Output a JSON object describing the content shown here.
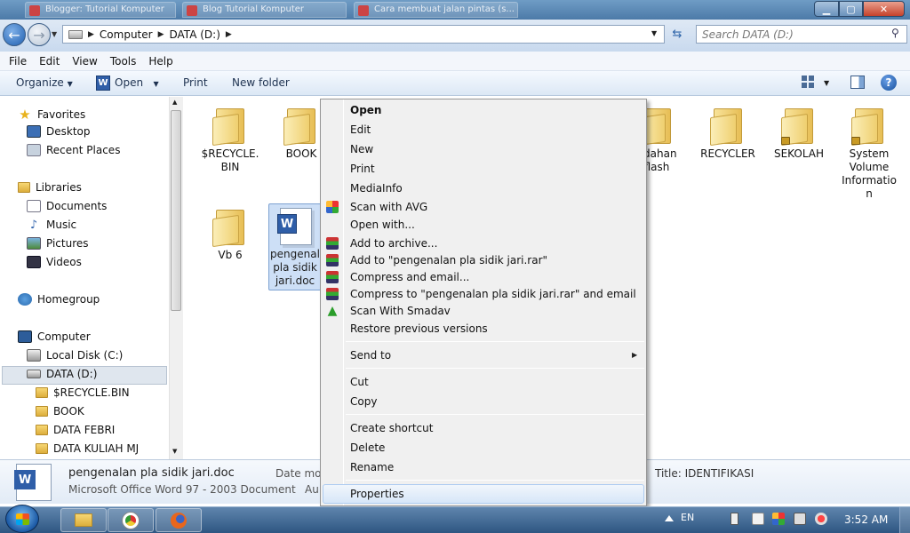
{
  "window": {
    "ghost_tabs": [
      "Blogger: Tutorial Komputer",
      "Blog Tutorial Komputer",
      "Cara membuat jalan pintas (s..."
    ]
  },
  "address": {
    "crumbs": [
      "Computer",
      "DATA (D:)"
    ],
    "search_placeholder": "Search DATA (D:)"
  },
  "menubar": [
    "File",
    "Edit",
    "View",
    "Tools",
    "Help"
  ],
  "toolbar": {
    "organize": "Organize",
    "open": "Open",
    "print": "Print",
    "new_folder": "New folder"
  },
  "nav": {
    "favorites": "Favorites",
    "desktop": "Desktop",
    "recent": "Recent Places",
    "libraries": "Libraries",
    "documents": "Documents",
    "music": "Music",
    "pictures": "Pictures",
    "videos": "Videos",
    "homegroup": "Homegroup",
    "computer": "Computer",
    "local_disk": "Local Disk (C:)",
    "data_d": "DATA (D:)",
    "sub": [
      "$RECYCLE.BIN",
      "BOOK",
      "DATA FEBRI",
      "DATA KULIAH MJ"
    ]
  },
  "files": {
    "recycle": "$RECYCLE.\nBIN",
    "book": "BOOK",
    "vb6": "Vb 6",
    "doc": "pengenalan pla sidik jari.doc",
    "pindahan": "ndahan flash",
    "recycler": "RECYCLER",
    "sekolah": "SEKOLAH",
    "svi": "System Volume Informatio n"
  },
  "details": {
    "name": "pengenalan pla sidik jari.doc",
    "type": "Microsoft Office Word 97 - 2003 Document",
    "date_label": "Date mod",
    "author_label": "Au",
    "title": "Title: IDENTIFIKASI"
  },
  "context_menu": {
    "open": "Open",
    "edit": "Edit",
    "new": "New",
    "print": "Print",
    "mediainfo": "MediaInfo",
    "scan_avg": "Scan with AVG",
    "open_with": "Open with...",
    "add_archive": "Add to archive...",
    "add_rar": "Add to \"pengenalan pla sidik jari.rar\"",
    "compress_email": "Compress and email...",
    "compress_rar_email": "Compress to \"pengenalan pla sidik jari.rar\" and email",
    "smadav": "Scan With Smadav",
    "restore": "Restore previous versions",
    "send_to": "Send to",
    "cut": "Cut",
    "copy": "Copy",
    "create_shortcut": "Create shortcut",
    "delete": "Delete",
    "rename": "Rename",
    "properties": "Properties"
  },
  "taskbar": {
    "lang": "EN",
    "clock": "3:52 AM"
  },
  "colors": {
    "accent": "#2f5ea8",
    "selection": "#cddff6",
    "taskbar": "#2e5682"
  }
}
